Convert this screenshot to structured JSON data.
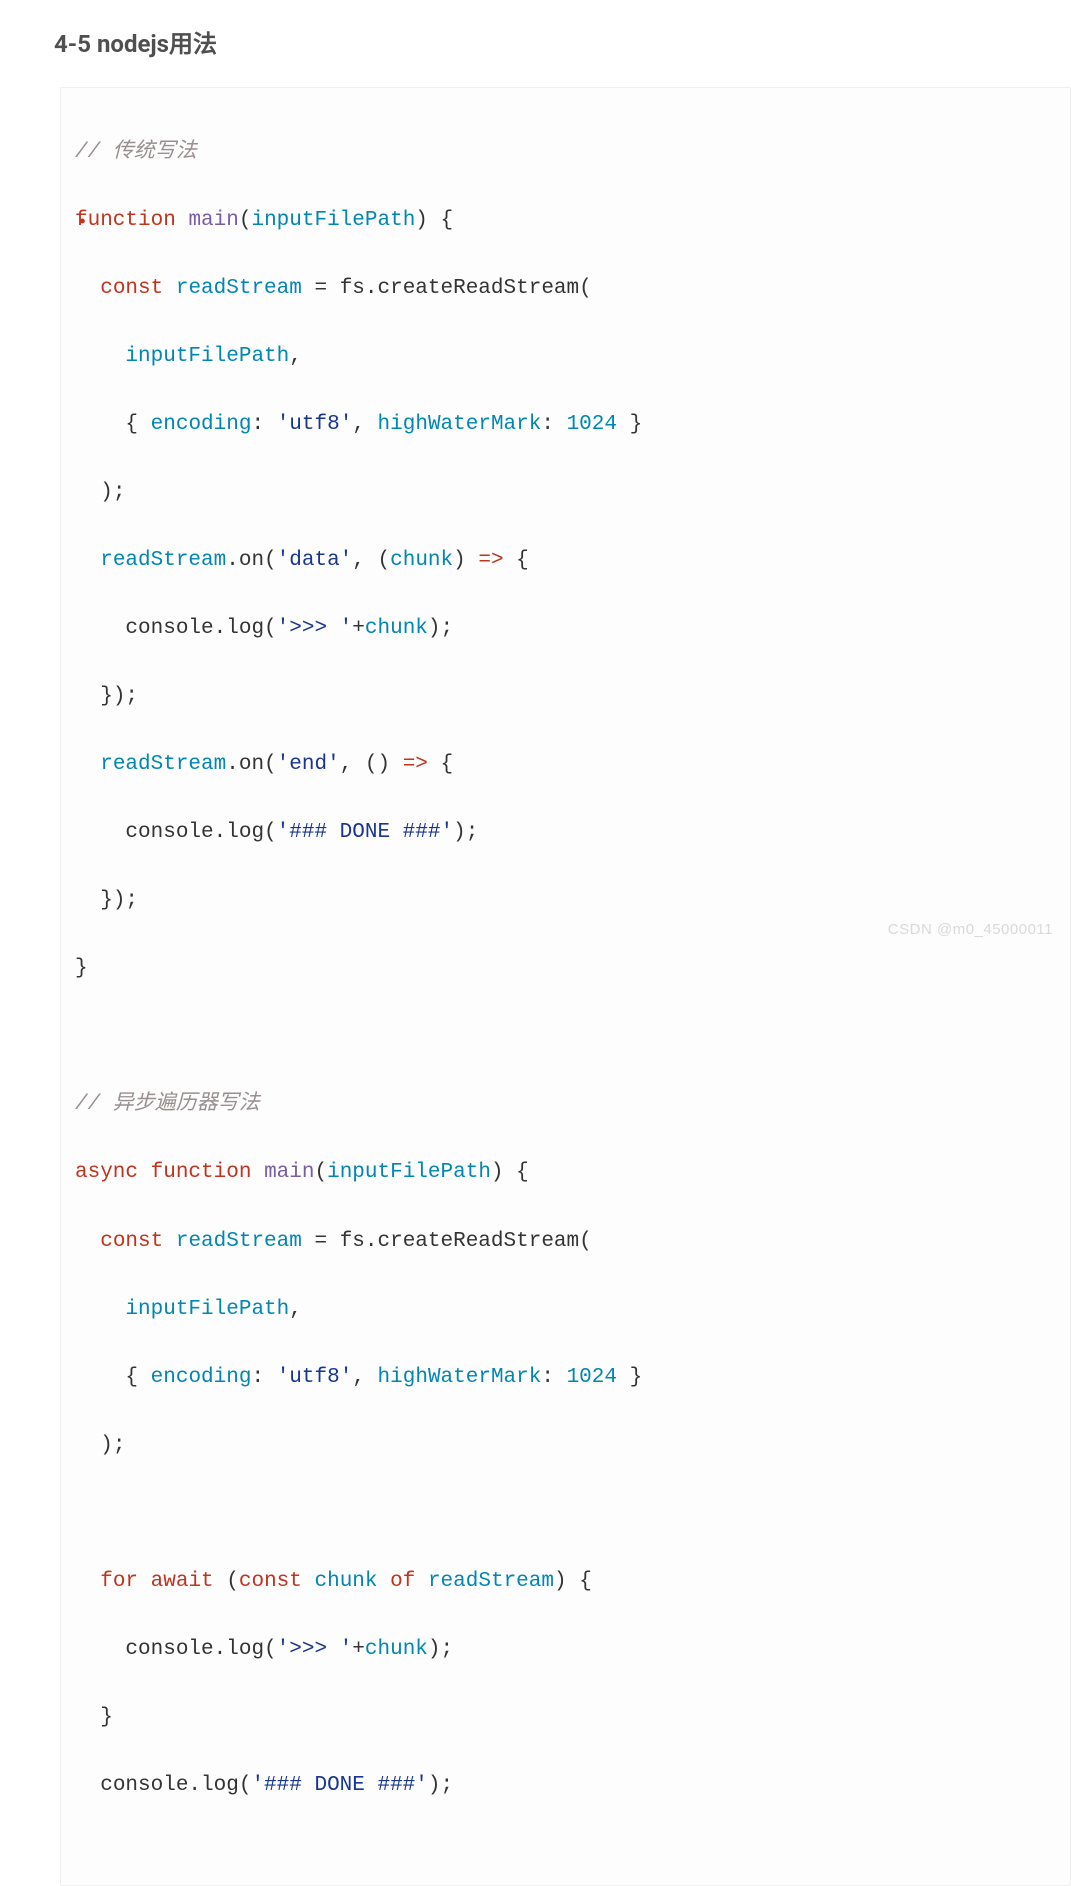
{
  "heading": "4-5 nodejs用法",
  "watermark": "CSDN @m0_45000011",
  "code": {
    "comments": {
      "c1": "// 传统写法",
      "c2": "// 异步遍历器写法"
    },
    "line2": {
      "kw1": "function",
      "fn": "main",
      "param": "inputFilePath",
      "punc": ") {"
    },
    "line3": {
      "kw": "const",
      "id": "readStream",
      "eq": " = ",
      "call": "fs.createReadStream("
    },
    "line4": {
      "id": "inputFilePath",
      "comma": ","
    },
    "line5": {
      "open": "{ ",
      "k1": "encoding",
      "col1": ": ",
      "s1": "'utf8'",
      "comma": ", ",
      "k2": "highWaterMark",
      "col2": ": ",
      "n1": "1024",
      "close": " }"
    },
    "line6": {
      "txt": ");"
    },
    "line7": {
      "id": "readStream",
      "call": ".on(",
      "s": "'data'",
      "mid": ", (",
      "p": "chunk",
      "arrow": ") => {",
      "arrowop": "=>"
    },
    "line8": {
      "pre": "console.log(",
      "s": "'>>> '",
      "plus": "+",
      "id": "chunk",
      "end": ");"
    },
    "line9": {
      "txt": "});"
    },
    "line10": {
      "id": "readStream",
      "call": ".on(",
      "s": "'end'",
      "mid": ", () ",
      "arrowop": "=>",
      "tail": " {"
    },
    "line11": {
      "pre": "console.log(",
      "s": "'### DONE ###'",
      "end": ");"
    },
    "line12": {
      "txt": "});"
    },
    "line13": {
      "txt": "}"
    },
    "line15": {
      "kw1": "async",
      "kw2": "function",
      "fn": "main",
      "param": "inputFilePath",
      "tail": ") {"
    },
    "line16": {
      "kw": "const",
      "id": "readStream",
      "eq": " = ",
      "call": "fs.createReadStream("
    },
    "line17": {
      "id": "inputFilePath",
      "comma": ","
    },
    "line18": {
      "open": "{ ",
      "k1": "encoding",
      "col1": ": ",
      "s1": "'utf8'",
      "comma": ", ",
      "k2": "highWaterMark",
      "col2": ": ",
      "n1": "1024",
      "close": " }"
    },
    "line19": {
      "txt": ");"
    },
    "line21": {
      "kw1": "for",
      "kw2": "await",
      "open": " (",
      "kw3": "const",
      "id": "chunk",
      "kw4": "of",
      "id2": "readStream",
      "close": ") {"
    },
    "line22": {
      "pre": "console.log(",
      "s": "'>>> '",
      "plus": "+",
      "id": "chunk",
      "end": ");"
    },
    "line23": {
      "txt": "}"
    },
    "line24": {
      "pre": "console.log(",
      "s": "'### DONE ###'",
      "end": ");"
    }
  }
}
